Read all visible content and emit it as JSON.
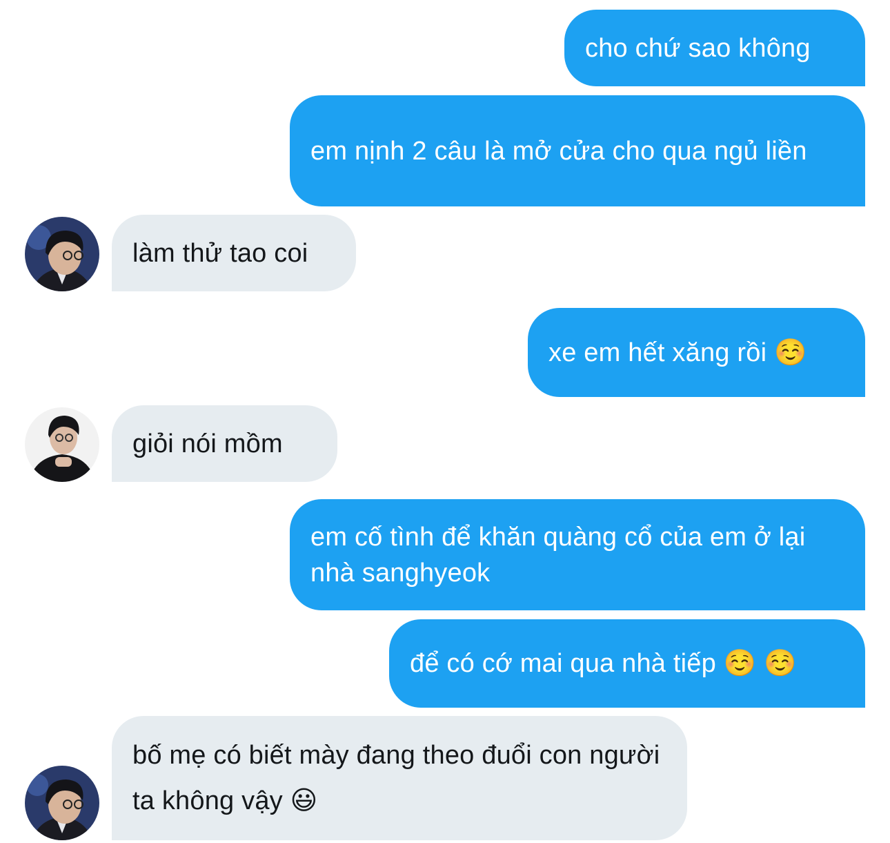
{
  "messages": [
    {
      "sender": "me",
      "text": "cho chứ sao không"
    },
    {
      "sender": "me",
      "text": "em nịnh 2 câu là mở cửa cho qua ngủ liền"
    },
    {
      "sender": "them",
      "text": "làm thử tao coi",
      "avatar": "profile-photo"
    },
    {
      "sender": "me",
      "text": "xe em hết xăng rồi ☺️"
    },
    {
      "sender": "them",
      "text": "giỏi nói mồm",
      "avatar": "profile-photo"
    },
    {
      "sender": "me",
      "text": "em cố tình để khăn quàng cổ của em ở lại nhà sanghyeok"
    },
    {
      "sender": "me",
      "text": "để có cớ mai qua nhà tiếp ☺️ ☺️"
    },
    {
      "sender": "them",
      "text": "bố mẹ có biết mày đang theo đuổi con người ta không vậy 😃",
      "avatar": "profile-photo"
    }
  ],
  "colors": {
    "outgoing_bubble": "#1DA1F2",
    "incoming_bubble": "#E6ECF0",
    "outgoing_text": "#FFFFFF",
    "incoming_text": "#14171A"
  }
}
